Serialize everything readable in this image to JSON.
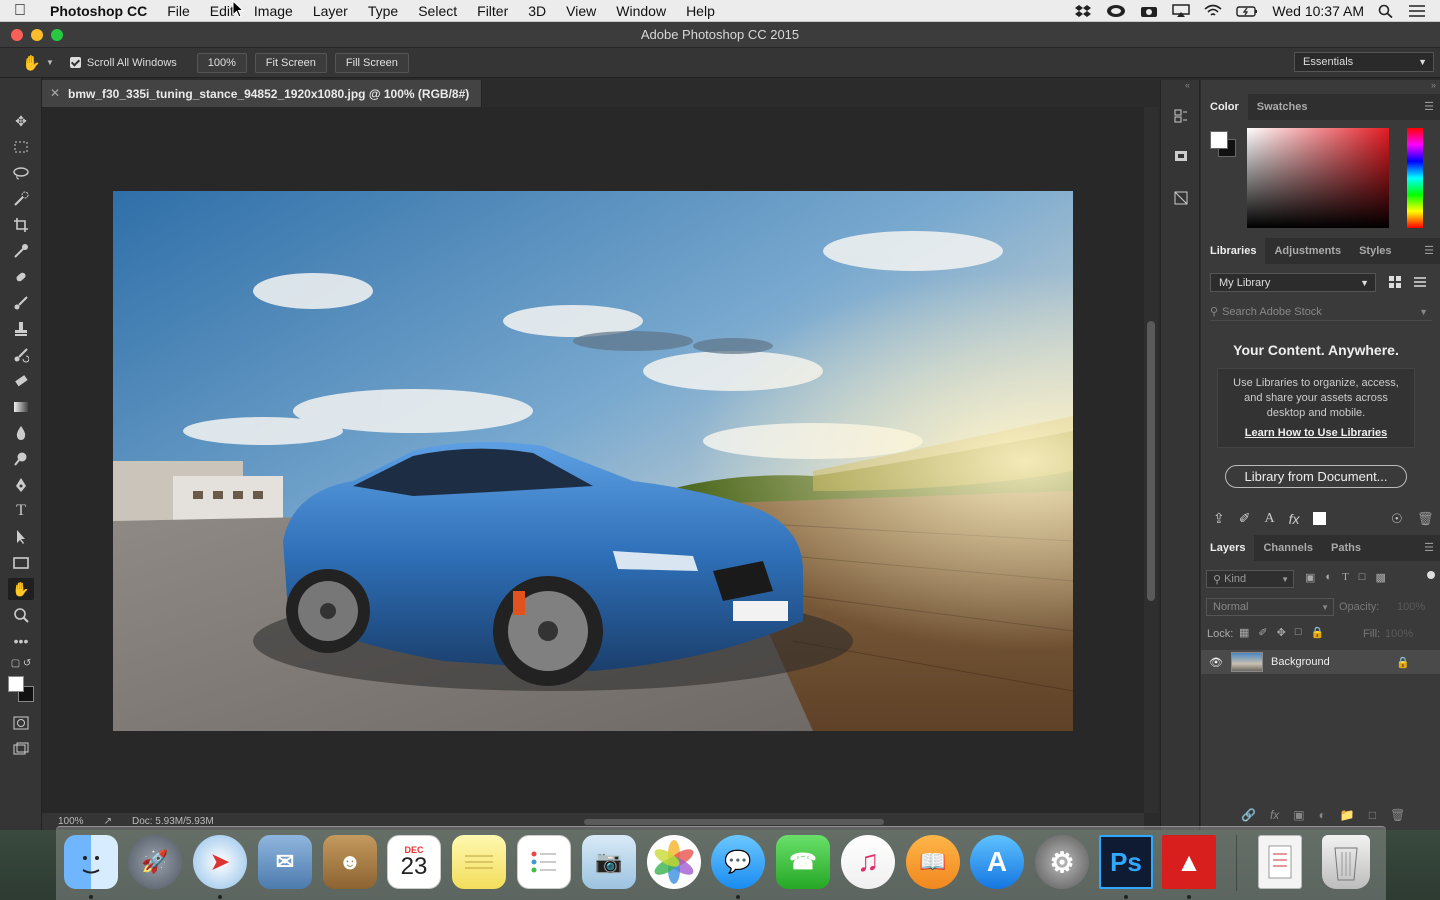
{
  "menubar": {
    "app": "Photoshop CC",
    "items": [
      "File",
      "Edit",
      "Image",
      "Layer",
      "Type",
      "Select",
      "Filter",
      "3D",
      "View",
      "Window",
      "Help"
    ],
    "clock": "Wed 10:37 AM"
  },
  "window": {
    "title": "Adobe Photoshop CC 2015"
  },
  "options": {
    "scroll_all_label": "Scroll All Windows",
    "zoom": "100%",
    "fit_screen": "Fit Screen",
    "fill_screen": "Fill Screen",
    "workspace": "Essentials"
  },
  "document": {
    "tab_title": "bmw_f30_335i_tuning_stance_94852_1920x1080.jpg @ 100% (RGB/8#)",
    "status_zoom": "100%",
    "status_doc": "Doc: 5.93M/5.93M"
  },
  "color_panel": {
    "tabs": [
      "Color",
      "Swatches"
    ]
  },
  "libraries_panel": {
    "tabs": [
      "Libraries",
      "Adjustments",
      "Styles"
    ],
    "library": "My Library",
    "search_placeholder": "Search Adobe Stock",
    "heading": "Your Content. Anywhere.",
    "body": "Use Libraries to organize, access, and share your assets across desktop and mobile.",
    "link": "Learn How to Use Libraries",
    "button": "Library from Document..."
  },
  "layers_panel": {
    "tabs": [
      "Layers",
      "Channels",
      "Paths"
    ],
    "kind": "Kind",
    "blend_mode": "Normal",
    "opacity_label": "Opacity:",
    "opacity_value": "100%",
    "lock_label": "Lock:",
    "fill_label": "Fill:",
    "fill_value": "100%",
    "layer_name": "Background"
  },
  "dock": {
    "calendar_month": "DEC",
    "calendar_day": "23",
    "ps_label": "Ps"
  }
}
